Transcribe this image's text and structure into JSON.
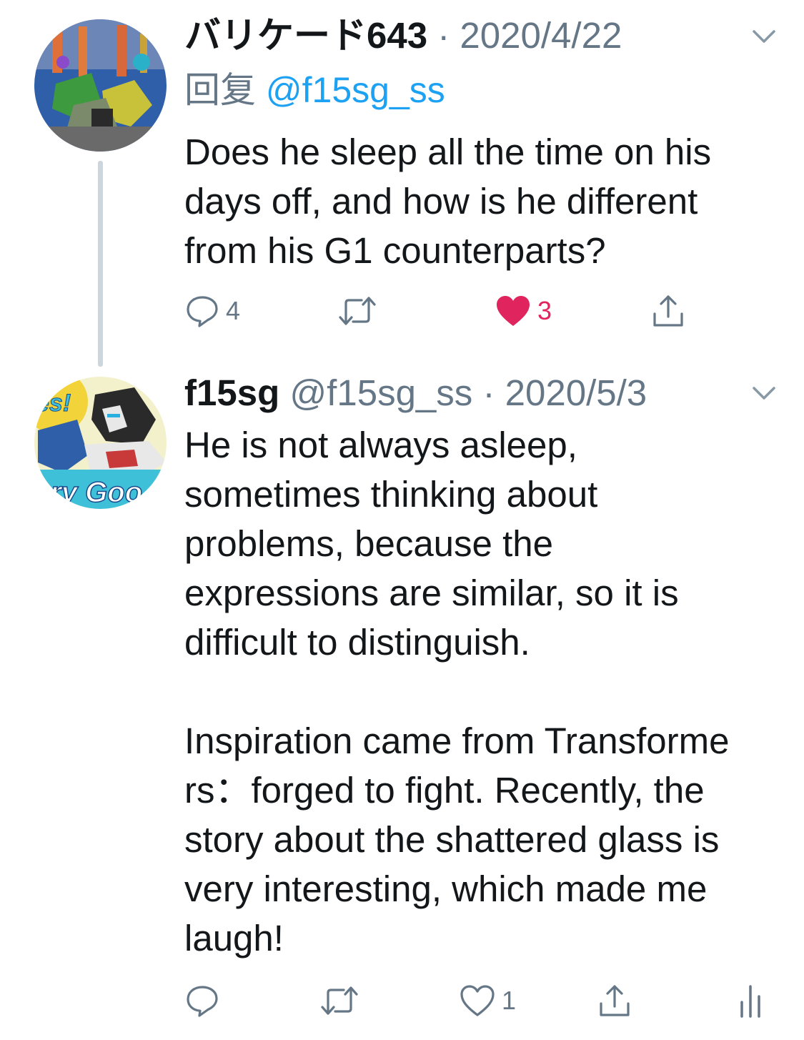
{
  "colors": {
    "text": "#14171a",
    "secondary": "#657786",
    "link": "#1da1f2",
    "like": "#e0245e",
    "thread_line": "#ccd6dd"
  },
  "tweets": [
    {
      "display_name": "バリケード643",
      "separator": " · ",
      "date": "2020/4/22",
      "reply_prefix": "回复 ",
      "reply_handle": "@f15sg_ss",
      "lines": [
        "Does he sleep all the time on his",
        "days off, and how is he different",
        "from his G1 counterparts?"
      ],
      "actions": {
        "reply_count": "4",
        "retweet_count": "",
        "like_count": "3",
        "liked": true
      },
      "icons": [
        "avatar",
        "chevron-down-icon",
        "reply-icon",
        "retweet-icon",
        "heart-filled-icon",
        "share-icon"
      ]
    },
    {
      "display_name": "f15sg",
      "handle": " @f15sg_ss",
      "separator": " · ",
      "date": "2020/5/3",
      "lines": [
        "He is not always asleep,",
        "sometimes thinking about",
        "problems, because the",
        "expressions are similar, so it is",
        "difficult to distinguish.",
        "",
        "Inspiration came from Transforme",
        "rs：forged to fight. Recently, the",
        "story about the shattered glass is",
        "very interesting, which made me",
        "laugh!"
      ],
      "actions": {
        "reply_count": "",
        "retweet_count": "",
        "like_count": "1",
        "liked": false
      },
      "icons": [
        "avatar",
        "chevron-down-icon",
        "reply-icon",
        "retweet-icon",
        "heart-outline-icon",
        "share-icon",
        "analytics-icon"
      ]
    }
  ]
}
